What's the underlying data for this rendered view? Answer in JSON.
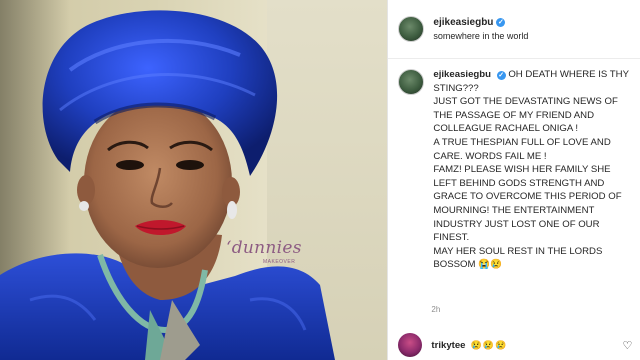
{
  "post": {
    "username": "ejikeasiegbu",
    "location": "somewhere in the world",
    "caption": "OH DEATH WHERE IS THY STING???\nJUST GOT THE DEVASTATING NEWS OF THE PASSAGE OF MY FRIEND AND COLLEAGUE RACHAEL ONIGA !\nA TRUE THESPIAN FULL OF LOVE AND CARE. WORDS FAIL ME !\nFAMZ! PLEASE WISH HER FAMILY SHE LEFT BEHIND GODS STRENGTH AND GRACE TO OVERCOME THIS PERIOD OF MOURNING! THE ENTERTAINMENT INDUSTRY JUST LOST ONE OF OUR FINEST.\nMAY HER SOUL REST IN THE LORDS BOSSOM 😭😢",
    "time": "2h"
  },
  "photo": {
    "watermark": "‘dunnies",
    "watermark_sub": "MAKEOVER"
  },
  "comment": {
    "username": "trikytee",
    "text": "😢😢😢"
  },
  "icons": {
    "verified": "verified-badge-icon",
    "like": "heart-outline-icon"
  },
  "colors": {
    "verified_blue": "#3897f0",
    "gele_blue": "#1f3fbf"
  }
}
